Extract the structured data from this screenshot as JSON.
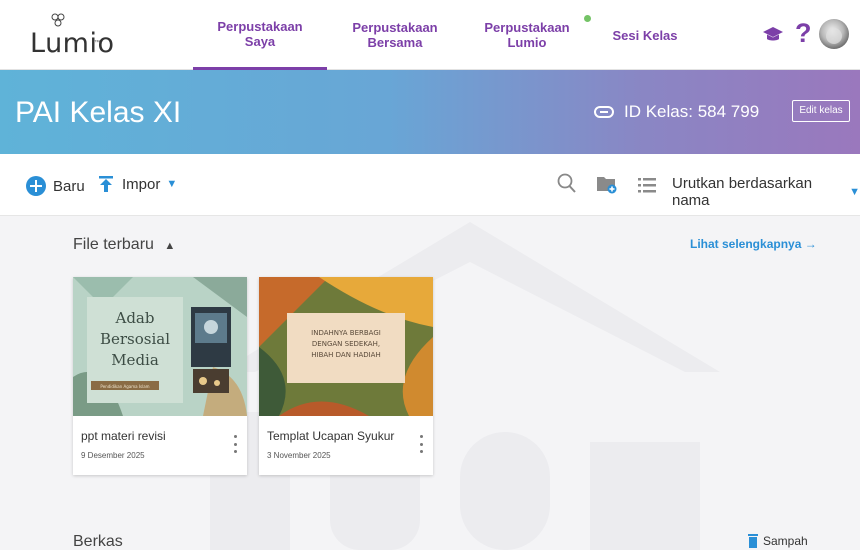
{
  "app": {
    "logo_text": "Lumio"
  },
  "nav": {
    "tabs": [
      {
        "label": "Perpustakaan\nSaya",
        "active": true
      },
      {
        "label": "Perpustakaan\nBersama",
        "active": false
      },
      {
        "label": "Perpustakaan\nLumio",
        "active": false
      },
      {
        "label": "Sesi Kelas",
        "active": false
      }
    ],
    "help_label": "?"
  },
  "banner": {
    "title": "PAI Kelas XI",
    "class_id_label": "ID Kelas: 584 799",
    "edit_label": "Edit kelas"
  },
  "toolbar": {
    "new_label": "Baru",
    "import_label": "Impor",
    "sort_label": "Urutkan berdasarkan nama"
  },
  "recent": {
    "title": "File terbaru",
    "see_more": "Lihat selengkapnya →",
    "files": [
      {
        "name": "ppt materi revisi",
        "date": "9 Desember 2025",
        "thumb_title_lines": [
          "Adab",
          "Bersosial",
          "Media"
        ],
        "thumb_subtitle": "Pendidikan Agama Islam"
      },
      {
        "name": "Templat Ucapan Syukur",
        "date": "3 November 2025",
        "thumb_title_lines": [
          "INDAHNYA BERBAGI",
          "DENGAN SEDEKAH,",
          "HIBAH DAN HADIAH"
        ]
      }
    ]
  },
  "files_section": {
    "title": "Berkas",
    "trash_label": "Sampah"
  },
  "colors": {
    "accent_purple": "#7c3fa8",
    "accent_blue": "#2a8fd6",
    "status_green": "#74c366"
  }
}
